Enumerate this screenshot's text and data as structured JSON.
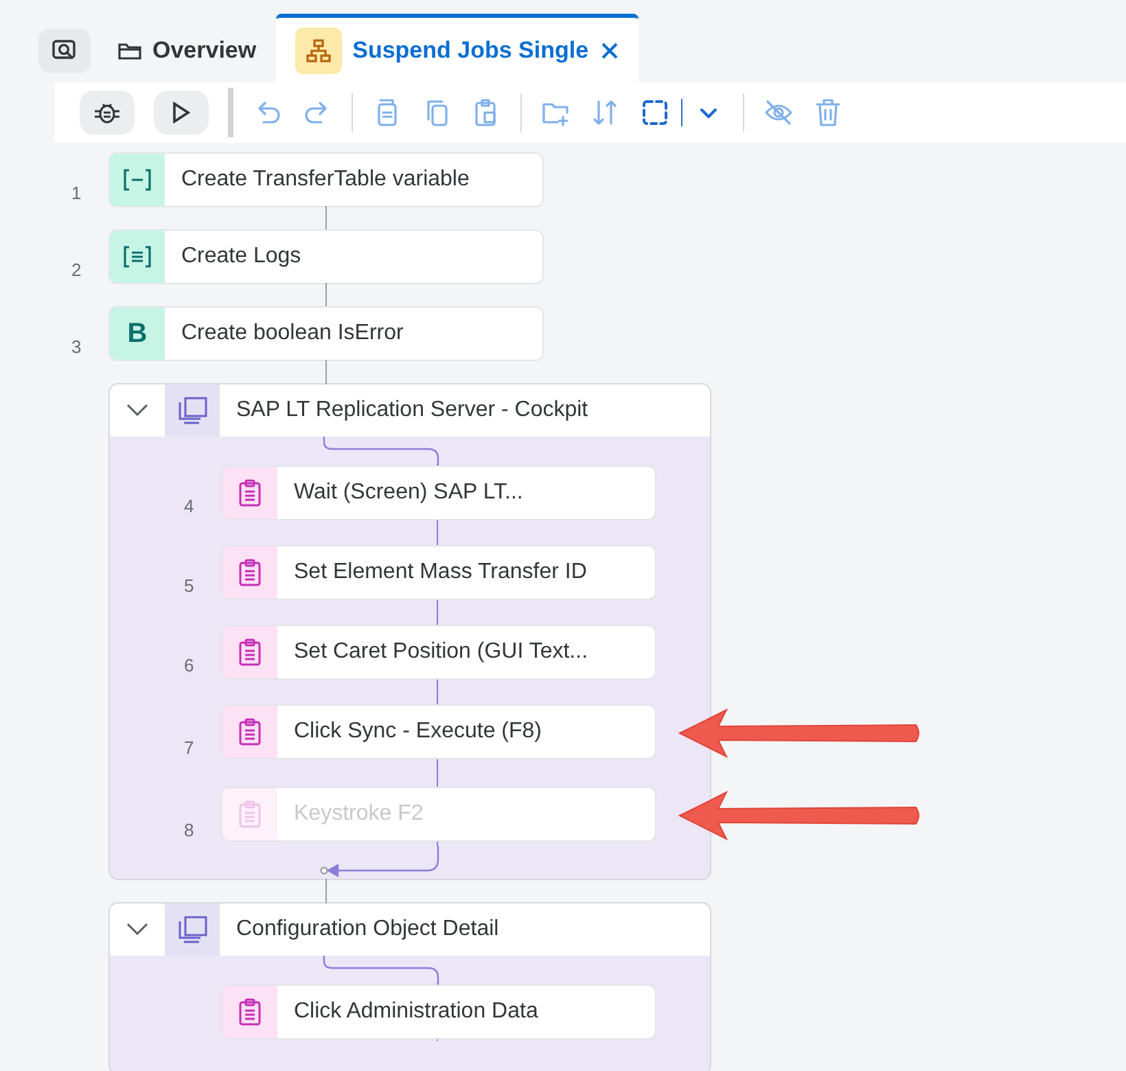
{
  "tabs": [
    {
      "kind": "search",
      "selected": false
    },
    {
      "kind": "folder",
      "label": "Overview",
      "selected": false
    },
    {
      "kind": "flow",
      "label": "Suspend Jobs Single",
      "selected": true,
      "closable": true
    }
  ],
  "flow": [
    {
      "kind": "variable",
      "number": "1",
      "label": "Create TransferTable variable"
    },
    {
      "kind": "list",
      "number": "2",
      "label": "Create Logs"
    },
    {
      "kind": "letter",
      "number": "3",
      "icon_text": "B",
      "label": "Create boolean IsError"
    },
    {
      "kind": "group",
      "label": "SAP LT Replication Server - Cockpit",
      "expanded": true,
      "steps": [
        {
          "number": "4",
          "kind": "activity",
          "label": "Wait (Screen) SAP LT...",
          "disabled": false,
          "marked": false
        },
        {
          "number": "5",
          "kind": "activity",
          "label": "Set Element Mass Transfer ID",
          "disabled": false,
          "marked": false
        },
        {
          "number": "6",
          "kind": "activity",
          "label": "Set Caret Position (GUI Text...",
          "disabled": false,
          "marked": false
        },
        {
          "number": "7",
          "kind": "activity",
          "label": "Click Sync - Execute (F8)",
          "disabled": false,
          "marked": true
        },
        {
          "number": "8",
          "kind": "activity",
          "label": "Keystroke F2",
          "disabled": true,
          "marked": true
        }
      ]
    },
    {
      "kind": "group",
      "label": "Configuration Object Detail",
      "expanded": true,
      "steps": [
        {
          "kind": "activity",
          "label": "Click Administration Data",
          "disabled": false,
          "marked": false
        }
      ]
    }
  ]
}
